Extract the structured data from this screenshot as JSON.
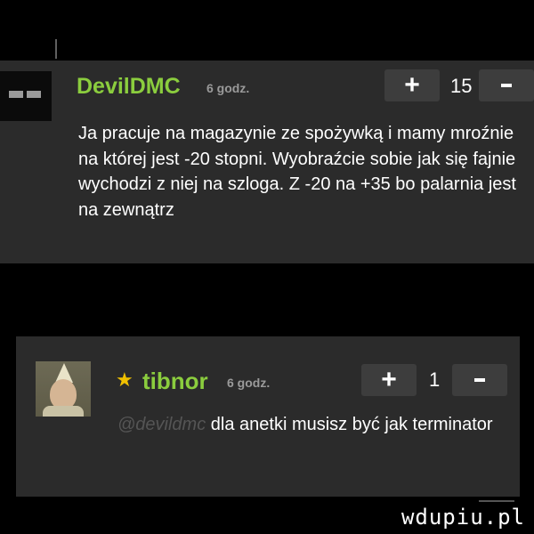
{
  "comments": [
    {
      "username": "DevilDMC",
      "time": "6 godz.",
      "score": "15",
      "plus_label": "+",
      "text": "Ja pracuje na magazynie ze spożywką i mamy mroźnie na której jest -20 stopni. Wyobraźcie sobie jak się fajnie wychodzi z niej na szloga. Z -20 na +35 bo palarnia jest na zewnątrz"
    },
    {
      "username": "tibnor",
      "star_icon": "★",
      "time": "6 godz.",
      "score": "1",
      "plus_label": "+",
      "mention": "@devildmc",
      "text": " dla anetki musisz być jak terminator"
    }
  ],
  "watermark": "wdupiu.pl",
  "colors": {
    "username": "#8bcd3e",
    "card": "#2b2b2b",
    "button": "#3d3d3d",
    "star": "#f0c000"
  }
}
